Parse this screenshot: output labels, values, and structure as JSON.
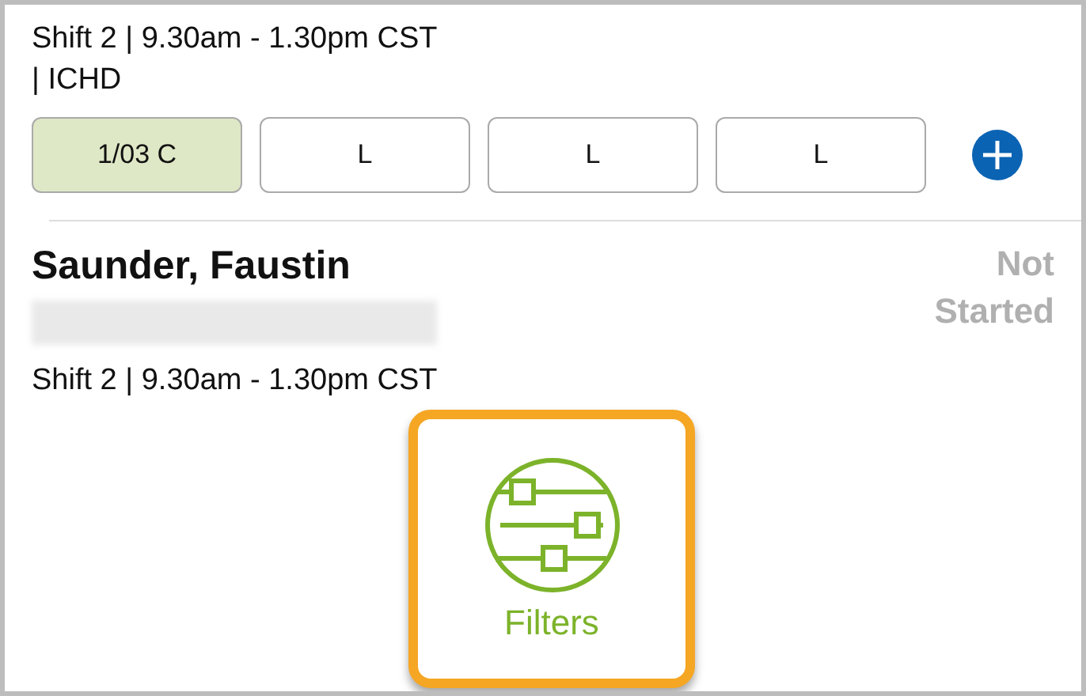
{
  "entries": [
    {
      "kind": "slots",
      "shift": "Shift 2 | 9.30am - 1.30pm CST",
      "unit": "| ICHD",
      "slots": [
        {
          "label": "1/03 C",
          "selected": true
        },
        {
          "label": "L",
          "selected": false
        },
        {
          "label": "L",
          "selected": false
        },
        {
          "label": "L",
          "selected": false
        }
      ]
    },
    {
      "kind": "patient",
      "name": "Saunder, Faustin",
      "status": "Not Started",
      "shift": "Shift 2 | 9.30am - 1.30pm CST"
    }
  ],
  "filters_button": {
    "label": "Filters"
  }
}
